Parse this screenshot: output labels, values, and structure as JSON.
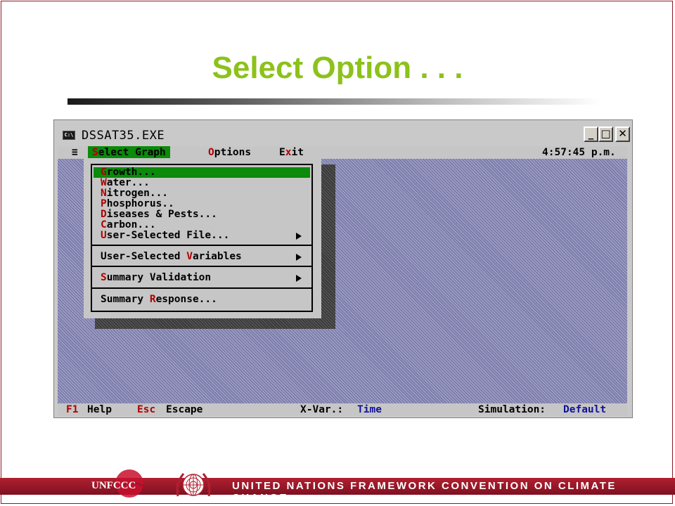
{
  "slide": {
    "title": "Select Option . . .",
    "footer_text": "UNITED NATIONS FRAMEWORK CONVENTION ON CLIMATE CHANGE",
    "unfccc_logo_text": "UNFCCC"
  },
  "window": {
    "title": "DSSAT35.EXE",
    "icon_text": "C:\\",
    "controls": {
      "minimize": "_",
      "maximize": "□",
      "close": "✕"
    }
  },
  "menubar": {
    "system_menu": "≡",
    "items": [
      {
        "hot": "S",
        "rest": "elect Graph"
      },
      {
        "hot": "O",
        "rest": "ptions"
      },
      {
        "pre": "E",
        "hot": "x",
        "rest": "it"
      }
    ],
    "clock": "4:57:45 p.m."
  },
  "dropdown": {
    "items": [
      {
        "hot": "G",
        "pre": "",
        "rest": "rowth..."
      },
      {
        "hot": "W",
        "pre": "",
        "rest": "ater..."
      },
      {
        "hot": "N",
        "pre": "",
        "rest": "itrogen..."
      },
      {
        "hot": "P",
        "pre": "",
        "rest": "hosphorus.."
      },
      {
        "hot": "D",
        "pre": "",
        "rest": "iseases & Pests..."
      },
      {
        "hot": "C",
        "pre": "",
        "rest": "arbon..."
      },
      {
        "hot": "U",
        "pre": "",
        "rest": "ser-Selected File..."
      },
      {
        "hot": "V",
        "pre": "User-Selected ",
        "rest": "ariables"
      },
      {
        "hot": "S",
        "pre": "",
        "rest": "ummary Validation"
      },
      {
        "hot": "R",
        "pre": "Summary ",
        "rest": "esponse..."
      }
    ]
  },
  "statusbar": {
    "f1_key": "F1",
    "f1_label": "Help",
    "esc_key": "Esc",
    "esc_label": "Escape",
    "xvar_label": "X-Var.:",
    "xvar_value": "Time",
    "sim_label": "Simulation:",
    "sim_value": "Default"
  }
}
